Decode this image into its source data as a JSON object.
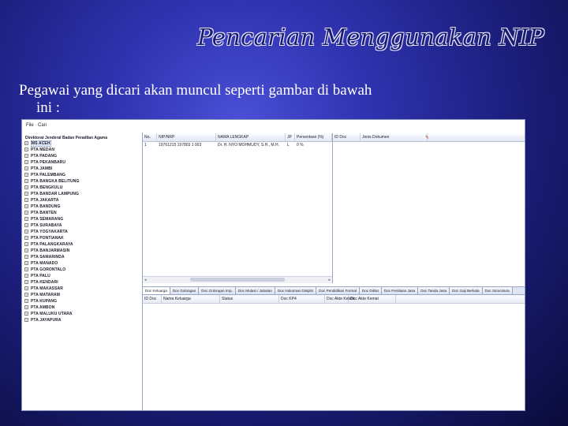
{
  "slide": {
    "title": "Pencarian Menggunakan NIP",
    "body_line1": "Pegawai yang dicari akan muncul seperti gambar di bawah",
    "body_line2": "ini :"
  },
  "app": {
    "menu_file": "File",
    "menu_cari": "Cari",
    "tree_root": "Direktorat Jenderal Badan Peradilan Agama",
    "tree_items": [
      "MS ACEH",
      "PTA MEDAN",
      "PTA PADANG",
      "PTA PEKANBARU",
      "PTA JAMBI",
      "PTA PALEMBANG",
      "PTA BANGKA BELITUNG",
      "PTA BENGKULU",
      "PTA BANDAR LAMPUNG",
      "PTA JAKARTA",
      "PTA BANDUNG",
      "PTA BANTEN",
      "PTA SEMARANG",
      "PTA SURABAYA",
      "PTA YOGYAKARTA",
      "PTA PONTIANAK",
      "PTA PALANGKARAYA",
      "PTA BANJARMASIN",
      "PTA SAMARINDA",
      "PTA MANADO",
      "PTA GORONTALO",
      "PTA PALU",
      "PTA KENDARI",
      "PTA MAKASSAR",
      "PTA MATARAM",
      "PTA KUPANG",
      "PTA AMBON",
      "PTA MALUKU UTARA",
      "PTA JAYAPURA"
    ],
    "grid": {
      "headers": [
        "No.",
        "NIP/NRP",
        "NAMA LENGKAP",
        "JP",
        "Persentase (%)"
      ],
      "rows": [
        [
          "1",
          "19761215 197803 1 003",
          "Dr. H. NYO MOHMUDY, S.H., M.H.",
          "L",
          "0 %"
        ]
      ]
    },
    "docs": {
      "headers": [
        "ID Doc",
        "Jenis Dokumen"
      ]
    },
    "tabs": [
      "Doc Keluarga",
      "Doc Golongan",
      "Doc Golongan Imp.",
      "Doc Mutasi / Jabatan",
      "Doc Hukuman Disiplin",
      "Doc Pendidikan Formal",
      "Doc Diklat",
      "Doc Penilaian Jasa",
      "Doc Tanda Jasa",
      "Doc Gaji Berkala",
      "Doc Sinocstura"
    ],
    "tab_columns": [
      "ID Doc",
      "Nama Keluarga",
      "Status",
      "Doc KP4",
      "Doc Akte Kelahi",
      "Doc Akte Kemat"
    ]
  }
}
